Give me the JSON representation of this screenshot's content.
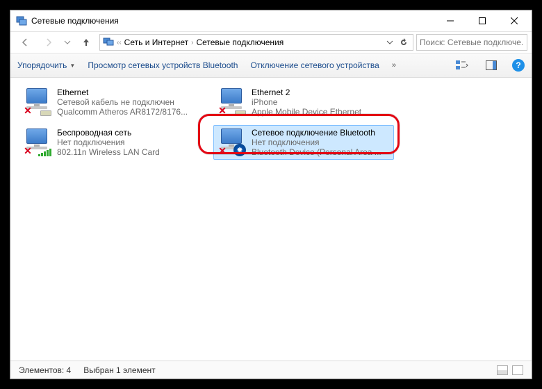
{
  "window": {
    "title": "Сетевые подключения"
  },
  "breadcrumb": {
    "root": "Сеть и Интернет",
    "leaf": "Сетевые подключения"
  },
  "search": {
    "placeholder": "Поиск: Сетевые подключе..."
  },
  "toolbar": {
    "organize": "Упорядочить",
    "view_bt": "Просмотр сетевых устройств Bluetooth",
    "disable": "Отключение сетевого устройства"
  },
  "items": [
    {
      "name": "Ethernet",
      "status": "Сетевой кабель не подключен",
      "device": "Qualcomm Atheros AR8172/8176..."
    },
    {
      "name": "Ethernet 2",
      "status": "iPhone",
      "device": "Apple Mobile Device Ethernet"
    },
    {
      "name": "Беспроводная сеть",
      "status": "Нет подключения",
      "device": "802.11n Wireless LAN Card"
    },
    {
      "name": "Сетевое подключение Bluetooth",
      "status": "Нет подключения",
      "device": "Bluetooth Device (Personal Area ..."
    }
  ],
  "statusbar": {
    "count": "Элементов: 4",
    "selected": "Выбран 1 элемент"
  }
}
